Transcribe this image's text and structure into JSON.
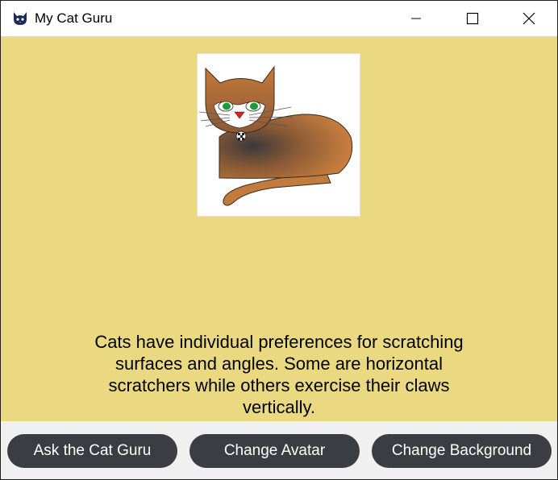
{
  "window": {
    "title": "My Cat Guru",
    "app_icon": "cat-face-icon",
    "controls": {
      "minimize_icon": "minimize-icon",
      "maximize_icon": "maximize-icon",
      "close_icon": "close-icon"
    }
  },
  "main": {
    "background_color": "#ebd982",
    "avatar": "cartoon-cat-avatar",
    "fact_text": "Cats have individual preferences for scratching surfaces and angles. Some are horizontal scratchers while others exercise their claws vertically."
  },
  "actions": {
    "ask_label": "Ask the Cat Guru",
    "change_avatar_label": "Change Avatar",
    "change_background_label": "Change Background",
    "button_color": "#3a3d41"
  }
}
